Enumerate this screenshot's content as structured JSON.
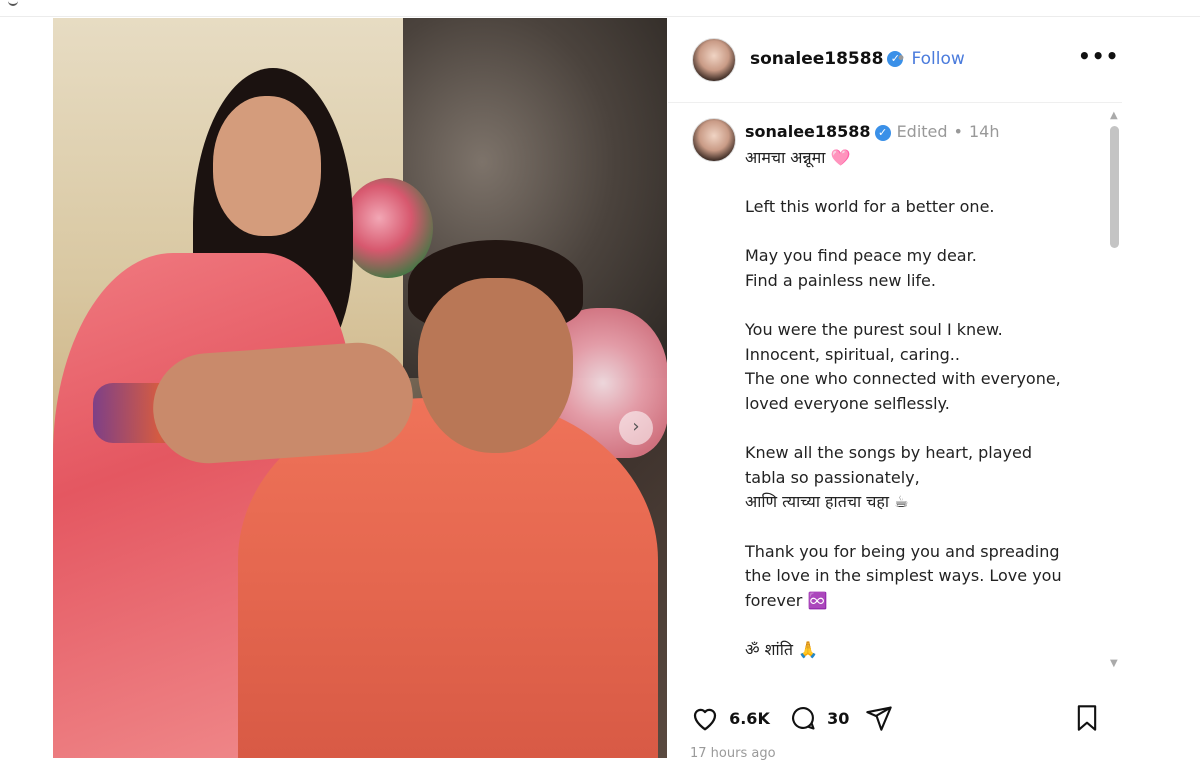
{
  "post": {
    "username": "sonalee18588",
    "follow_label": "Follow",
    "separator": "•",
    "more_label": "•••",
    "next_arrow": "›"
  },
  "caption": {
    "username": "sonalee18588",
    "edited": "Edited",
    "dot": "•",
    "time": "14h",
    "lines": [
      "आमचा अन्नूमा 🩷",
      "",
      "Left this world for a better one.",
      "",
      "May you find peace my dear.",
      "Find a painless new life.",
      "",
      "You were the purest soul I knew.",
      "Innocent, spiritual, caring..",
      "The one who connected with everyone,",
      "loved everyone selflessly.",
      "",
      "Knew all the songs by heart, played",
      "tabla so passionately,",
      "आणि त्याच्या हातचा चहा ☕",
      "",
      "Thank you for being you and spreading",
      "the love in the simplest ways. Love you",
      "forever ♾️",
      "",
      "ॐ शांति 🙏"
    ]
  },
  "stats": {
    "likes": "6.6K",
    "comments": "30"
  },
  "footer": {
    "time_ago": "17 hours ago"
  },
  "icons": {
    "like": "heart-icon",
    "comment": "comment-icon",
    "share": "share-icon",
    "save": "bookmark-icon",
    "verified": "verified-badge-icon"
  },
  "colors": {
    "follow": "#4a7bdc",
    "verified": "#3a90e8",
    "muted": "#999999"
  }
}
